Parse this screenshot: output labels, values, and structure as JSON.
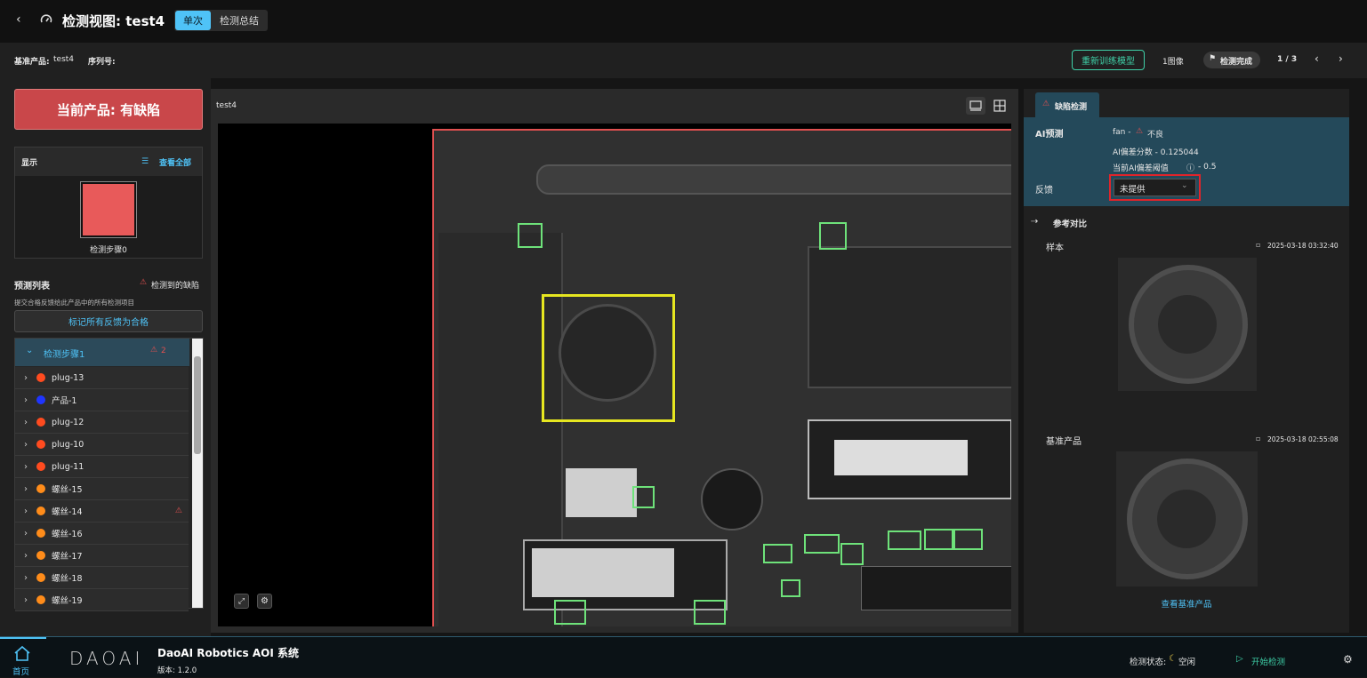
{
  "header": {
    "title": "检测视图: test4",
    "tab_single": "单次",
    "tab_summary": "检测总结"
  },
  "subbar": {
    "base_product_label": "基准产品:",
    "base_product_value": "test4",
    "serial_label": "序列号:",
    "retrain_label": "重新训练模型",
    "image_count": "1图像",
    "status_badge": "检测完成",
    "page_indicator": "1 / 3"
  },
  "left": {
    "product_status": "当前产品: 有缺陷",
    "display_title": "显示",
    "view_all": "查看全部",
    "step_label": "检测步骤0",
    "predict_title": "预测列表",
    "defect_found": "检测到的缺陷",
    "submit_note": "提交合格反馈给此产品中的所有检测项目",
    "mark_all_button": "标记所有反馈为合格",
    "group_label": "检测步骤1",
    "group_count": "2",
    "items": [
      {
        "label": "plug-13",
        "color": "#ff4b1f",
        "warn": false
      },
      {
        "label": "产品-1",
        "color": "#1f35ff",
        "warn": false
      },
      {
        "label": "plug-12",
        "color": "#ff4b1f",
        "warn": false
      },
      {
        "label": "plug-10",
        "color": "#ff4b1f",
        "warn": false
      },
      {
        "label": "plug-11",
        "color": "#ff4b1f",
        "warn": false
      },
      {
        "label": "螺丝-15",
        "color": "#ff8c1a",
        "warn": false
      },
      {
        "label": "螺丝-14",
        "color": "#ff8c1a",
        "warn": true
      },
      {
        "label": "螺丝-16",
        "color": "#ff8c1a",
        "warn": false
      },
      {
        "label": "螺丝-17",
        "color": "#ff8c1a",
        "warn": false
      },
      {
        "label": "螺丝-18",
        "color": "#ff8c1a",
        "warn": false
      },
      {
        "label": "螺丝-19",
        "color": "#ff8c1a",
        "warn": false
      }
    ]
  },
  "center": {
    "image_title": "test4"
  },
  "right": {
    "tab_label": "缺陷检测",
    "ai_predict_label": "AI预测",
    "ai_predict_value": "fan -",
    "ai_predict_result": "不良",
    "ai_score": "AI偏差分数 - 0.125044",
    "ai_threshold": "当前AI偏差阈值",
    "ai_threshold_value": "- 0.5",
    "feedback_label": "反馈",
    "feedback_value": "未提供",
    "reference_title": "参考对比",
    "sample_label": "样本",
    "sample_time": "2025-03-18 03:32:40",
    "base_label": "基准产品",
    "base_time": "2025-03-18 02:55:08",
    "view_base_link": "查看基准产品"
  },
  "footer": {
    "home_label": "首页",
    "logo_text": "DAOAI",
    "app_name": "DaoAI Robotics AOI 系统",
    "version": "版本: 1.2.0",
    "status_label": "检测状态:",
    "status_value": "空闲",
    "start_label": "开始检测"
  },
  "colors": {
    "accent": "#3fd0a8",
    "defect_red": "#d9534f",
    "link_blue": "#4fc3f7",
    "detection_green": "#6ee27a",
    "detection_yellow": "#e6e620"
  }
}
